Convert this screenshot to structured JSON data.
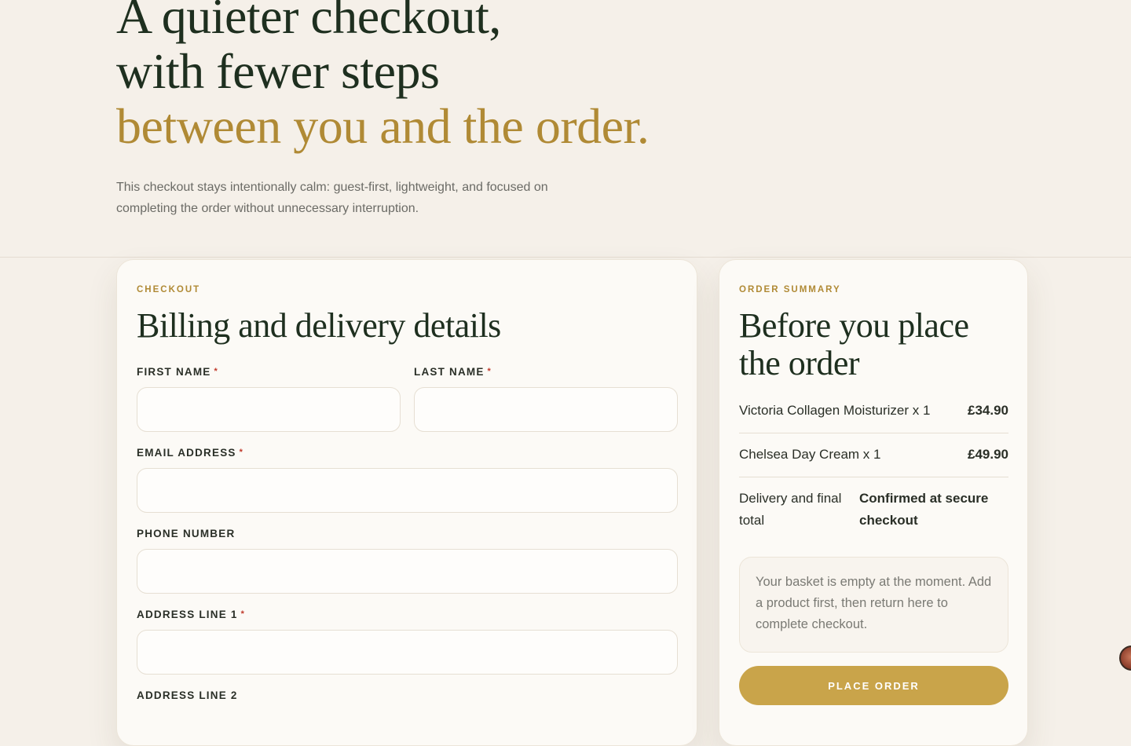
{
  "hero": {
    "title_line1": "A quieter checkout,",
    "title_line2": "with fewer steps",
    "title_line3": "between you and the order.",
    "description": "This checkout stays intentionally calm: guest-first, lightweight, and focused on completing the order without unnecessary interruption."
  },
  "form": {
    "eyebrow": "CHECKOUT",
    "title": "Billing and delivery details",
    "fields": {
      "first_name": {
        "label": "FIRST NAME",
        "required_mark": "*",
        "value": ""
      },
      "last_name": {
        "label": "LAST NAME",
        "required_mark": "*",
        "value": ""
      },
      "email": {
        "label": "EMAIL ADDRESS",
        "required_mark": "*",
        "value": ""
      },
      "phone": {
        "label": "PHONE NUMBER",
        "value": ""
      },
      "address1": {
        "label": "ADDRESS LINE 1",
        "required_mark": "*",
        "value": ""
      },
      "address2": {
        "label": "ADDRESS LINE 2"
      }
    }
  },
  "summary": {
    "eyebrow": "ORDER SUMMARY",
    "title": "Before you place the order",
    "items": [
      {
        "name": "Victoria Collagen Moisturizer x 1",
        "price": "£34.90"
      },
      {
        "name": "Chelsea Day Cream x 1",
        "price": "£49.90"
      }
    ],
    "total_label": "Delivery and final total",
    "total_value": "Confirmed at secure checkout",
    "notice": "Your basket is empty at the moment. Add a product first, then return here to complete checkout.",
    "place_order_label": "PLACE ORDER"
  },
  "colors": {
    "background": "#f5f0e9",
    "accent_gold": "#b08a35",
    "button_gold": "#c9a44a",
    "heading_green": "#1e2f1f",
    "required_red": "#c0392b"
  }
}
